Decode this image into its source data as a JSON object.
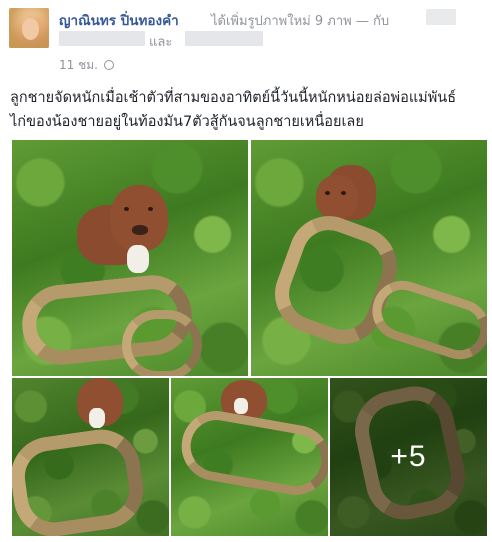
{
  "post": {
    "author": "ญาณินทร ปิ่นทองคำ",
    "action_text": "ได้เพิ่มรูปภาพใหม่ 9 ภาพ — กับ",
    "tag_connector": "และ",
    "timestamp": "11 ชม.",
    "privacy_icon": "globe-icon",
    "text_line_1": "ลูกชายจัดหนักเมื่อเช้าตัวที่สามของอาทิตย์นี้วันนี้หนักหน่อยล่อพ่อแม่พันธ์",
    "text_line_2": "ไก่ของน้องชายอยู่ในท้องมัน7ตัวสู้กันจนลูกชายเหนื่อยเลย"
  },
  "gallery": {
    "more_count_label": "+5",
    "photos": [
      {
        "description_icon": "photo-dog-and-python-1"
      },
      {
        "description_icon": "photo-dog-and-python-2"
      },
      {
        "description_icon": "photo-dog-and-python-3"
      },
      {
        "description_icon": "photo-dog-and-python-4"
      },
      {
        "description_icon": "photo-python-closeup-5"
      }
    ]
  },
  "colors": {
    "author_link": "#365899",
    "secondary_text": "#90949c",
    "body_text": "#1d2129"
  }
}
